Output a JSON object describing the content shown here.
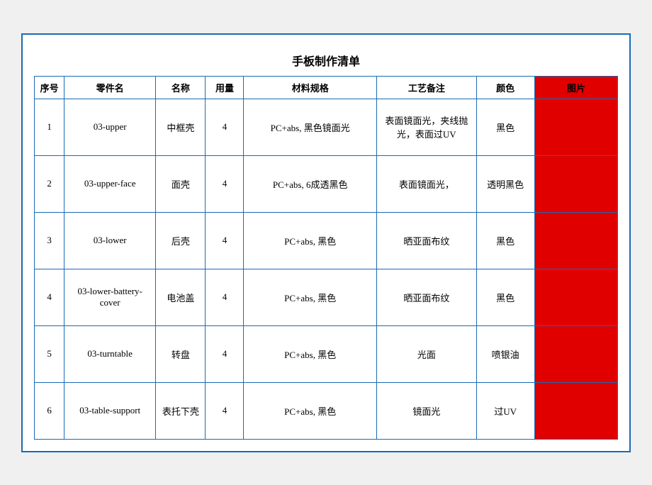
{
  "title": "手板制作清单",
  "columns": [
    "序号",
    "零件名",
    "名称",
    "用量",
    "材料规格",
    "工艺备注",
    "颜色",
    "图片"
  ],
  "rows": [
    {
      "seq": "1",
      "part": "03-upper",
      "name": "中框壳",
      "qty": "4",
      "material": "PC+abs, 黑色镜面光",
      "process": "表面镜面光，夹线抛光，表面过UV",
      "color": "黑色",
      "image": ""
    },
    {
      "seq": "2",
      "part": "03-upper-face",
      "name": "面壳",
      "qty": "4",
      "material": "PC+abs, 6成透黑色",
      "process": "表面镜面光，",
      "color": "透明黑色",
      "image": ""
    },
    {
      "seq": "3",
      "part": "03-lower",
      "name": "后壳",
      "qty": "4",
      "material": "PC+abs, 黑色",
      "process": "晒亚面布纹",
      "color": "黑色",
      "image": ""
    },
    {
      "seq": "4",
      "part": "03-lower-battery-cover",
      "name": "电池盖",
      "qty": "4",
      "material": "PC+abs, 黑色",
      "process": "晒亚面布纹",
      "color": "黑色",
      "image": ""
    },
    {
      "seq": "5",
      "part": "03-turntable",
      "name": "转盘",
      "qty": "4",
      "material": "PC+abs, 黑色",
      "process": "光面",
      "color": "喷银油",
      "image": ""
    },
    {
      "seq": "6",
      "part": "03-table-support",
      "name": "表托下壳",
      "qty": "4",
      "material": "PC+abs, 黑色",
      "process": "镜面光",
      "color": "过UV",
      "image": ""
    }
  ]
}
